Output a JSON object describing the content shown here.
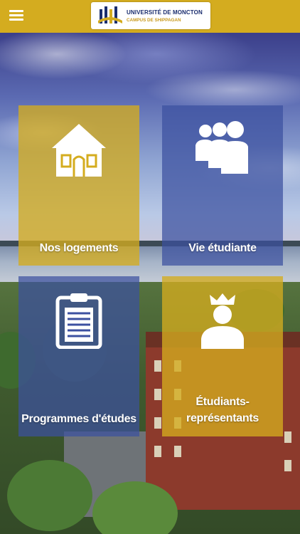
{
  "header": {
    "logo_line1": "UNIVERSITÉ DE MONCTON",
    "logo_line2": "CAMPUS DE SHIPPAGAN",
    "menu_icon": "hamburger-menu-icon",
    "logo_icon": "university-logo-icon"
  },
  "tiles": [
    {
      "label": "Nos logements",
      "icon": "house-icon",
      "color": "#d4ac1f"
    },
    {
      "label": "Vie étudiante",
      "icon": "group-people-icon",
      "color": "#3c50a0"
    },
    {
      "label": "Programmes d'études",
      "icon": "clipboard-icon",
      "color": "#3c50a0"
    },
    {
      "label_line1": "Étudiants-",
      "label_line2": "représentants",
      "icon": "crowned-person-icon",
      "color": "#d4ac1f"
    }
  ],
  "colors": {
    "header": "#d4ac1f",
    "brand_blue": "#1a2d6e"
  }
}
